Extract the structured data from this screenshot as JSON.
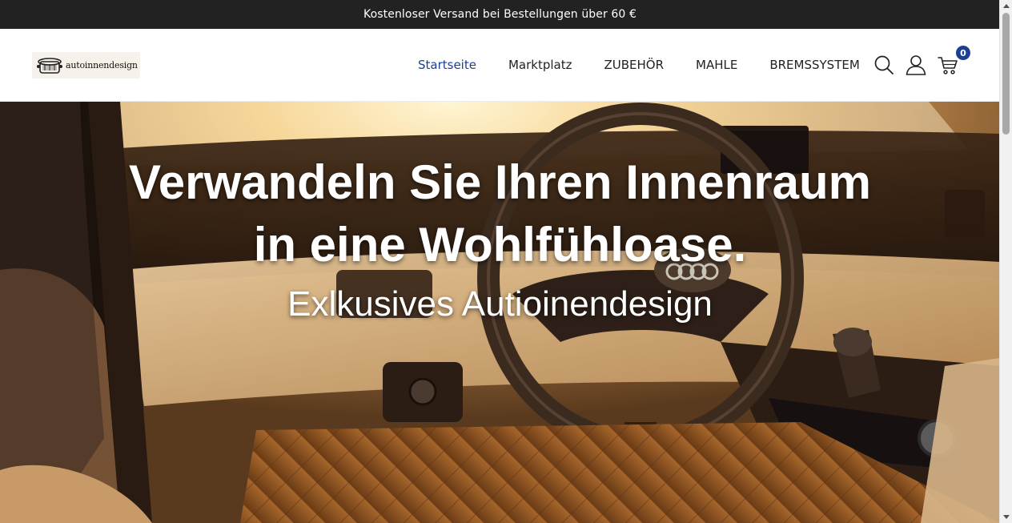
{
  "announcement": {
    "text": "Kostenloser Versand bei Bestellungen über 60 €"
  },
  "header": {
    "logo_text": "autoinnendesign",
    "nav": [
      {
        "label": "Startseite",
        "active": true
      },
      {
        "label": "Marktplatz",
        "active": false
      },
      {
        "label": "ZUBEHÖR",
        "active": false
      },
      {
        "label": "MAHLE",
        "active": false
      },
      {
        "label": "BREMSSYSTEM",
        "active": false
      }
    ],
    "icons": [
      "search-icon",
      "user-icon",
      "cart-icon"
    ],
    "cart_count": "0"
  },
  "hero": {
    "line1": "Verwandeln Sie Ihren Innenraum",
    "line2": "in eine Wohlfühloase.",
    "line3": "Exlkusives Autioinendesign"
  },
  "colors": {
    "announcement_bg": "#222222",
    "accent": "#1c3f94",
    "nav_text": "#222222"
  }
}
